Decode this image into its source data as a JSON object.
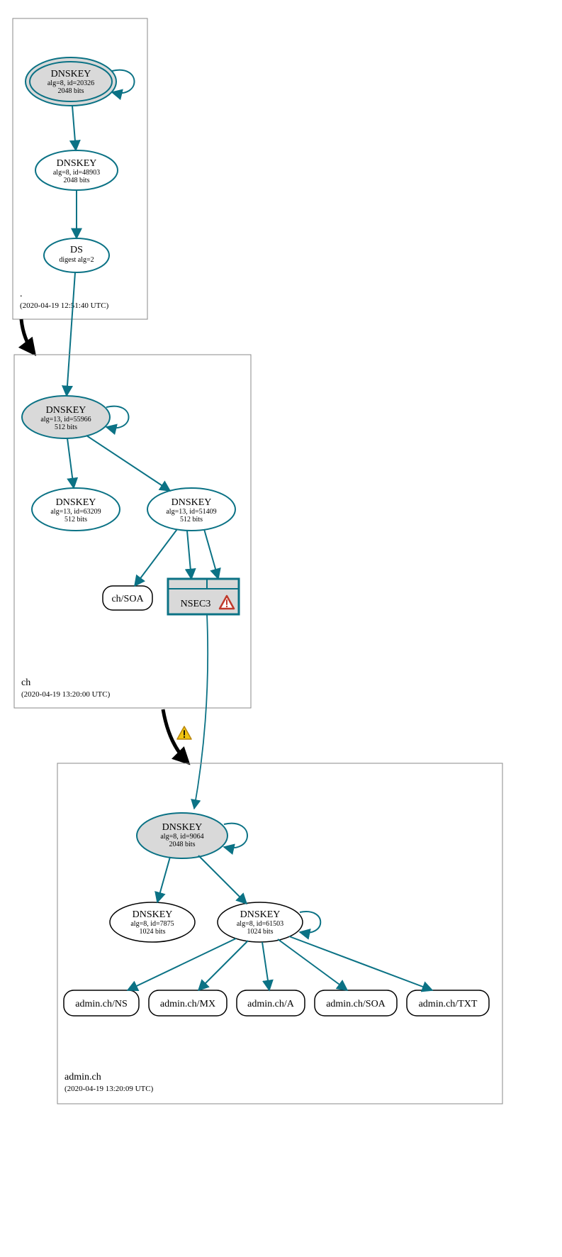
{
  "colors": {
    "teal": "#0b7285",
    "shade": "#d9d9d9",
    "black": "#000000",
    "warnYellow": "#f1c40f",
    "warnRed": "#c0392b"
  },
  "zones": {
    "root": {
      "name": ".",
      "timestamp": "(2020-04-19 12:51:40 UTC)"
    },
    "ch": {
      "name": "ch",
      "timestamp": "(2020-04-19 13:20:00 UTC)"
    },
    "admin": {
      "name": "admin.ch",
      "timestamp": "(2020-04-19 13:20:09 UTC)"
    }
  },
  "nodes": {
    "root_ksk": {
      "title": "DNSKEY",
      "l2": "alg=8, id=20326",
      "l3": "2048 bits"
    },
    "root_zsk": {
      "title": "DNSKEY",
      "l2": "alg=8, id=48903",
      "l3": "2048 bits"
    },
    "root_ds": {
      "title": "DS",
      "l2": "digest alg=2"
    },
    "ch_ksk": {
      "title": "DNSKEY",
      "l2": "alg=13, id=55966",
      "l3": "512 bits"
    },
    "ch_zsk1": {
      "title": "DNSKEY",
      "l2": "alg=13, id=63209",
      "l3": "512 bits"
    },
    "ch_zsk2": {
      "title": "DNSKEY",
      "l2": "alg=13, id=51409",
      "l3": "512 bits"
    },
    "ch_soa": {
      "label": "ch/SOA"
    },
    "ch_nsec3": {
      "label": "NSEC3"
    },
    "admin_ksk": {
      "title": "DNSKEY",
      "l2": "alg=8, id=9064",
      "l3": "2048 bits"
    },
    "admin_zsk1": {
      "title": "DNSKEY",
      "l2": "alg=8, id=7875",
      "l3": "1024 bits"
    },
    "admin_zsk2": {
      "title": "DNSKEY",
      "l2": "alg=8, id=61503",
      "l3": "1024 bits"
    },
    "admin_ns": {
      "label": "admin.ch/NS"
    },
    "admin_mx": {
      "label": "admin.ch/MX"
    },
    "admin_a": {
      "label": "admin.ch/A"
    },
    "admin_soa": {
      "label": "admin.ch/SOA"
    },
    "admin_txt": {
      "label": "admin.ch/TXT"
    }
  }
}
